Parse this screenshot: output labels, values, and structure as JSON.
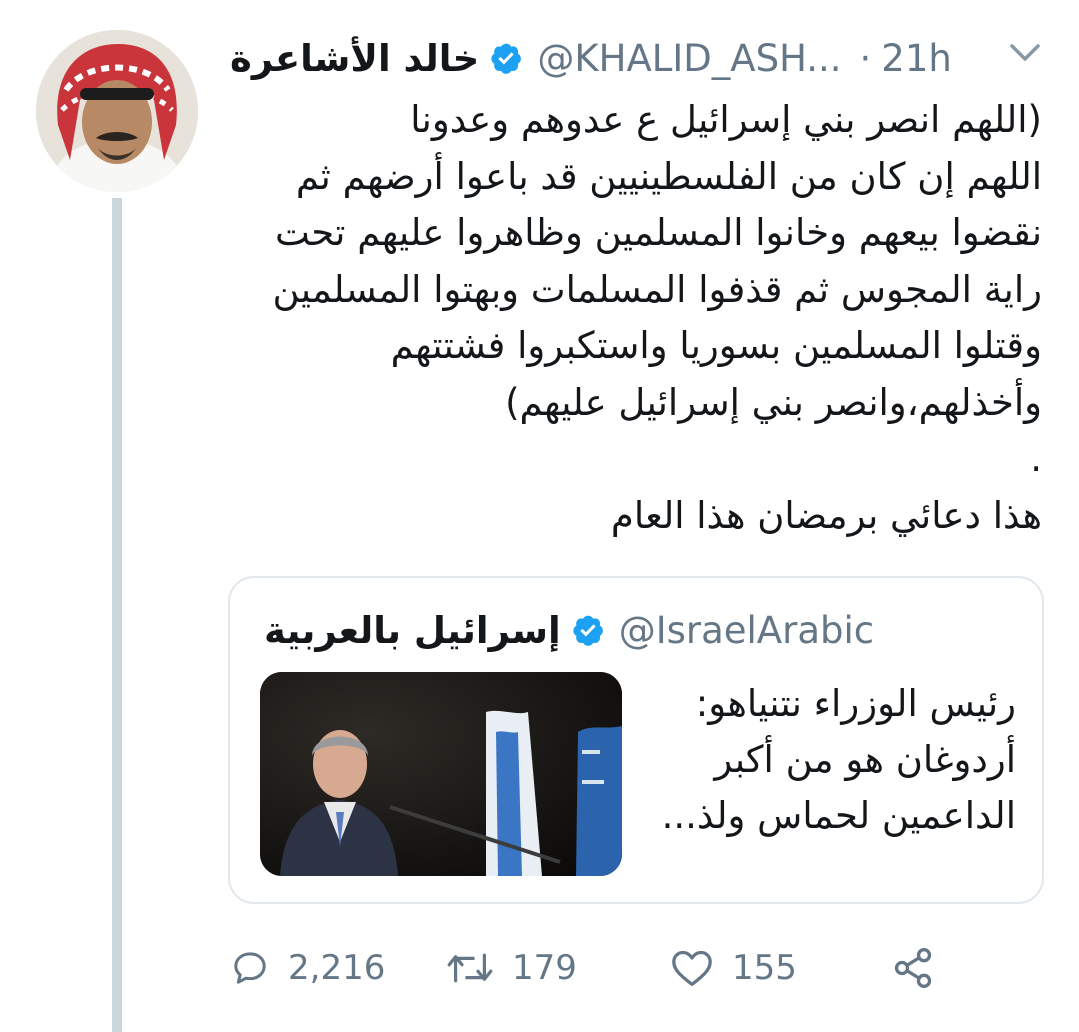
{
  "tweet": {
    "author": {
      "display_name": "خالد الأشاعرة",
      "handle": "@KHALID_ASH...",
      "verified": true,
      "avatar_icon": "profile-photo-man-red-shemagh"
    },
    "separator": "·",
    "timestamp": "21h",
    "text": "(اللهم انصر بني إسرائيل ع عدوهم وعدونا\nاللهم إن كان من الفلسطينيين قد باعوا أرضهم ثم\nنقضوا بيعهم وخانوا المسلمين وظاهروا عليهم تحت\nراية المجوس ثم قذفوا المسلمات وبهتوا المسلمين\nوقتلوا المسلمين بسوريا واستكبروا فشتتهم\nوأخذلهم،وانصر بني إسرائيل عليهم)\n.\nهذا دعائي برمضان هذا العام",
    "quoted": {
      "display_name": "إسرائيل بالعربية",
      "handle": "@IsraelArabic",
      "verified": true,
      "text": "رئيس الوزراء نتنياهو:\nأردوغان هو من أكبر\nالداعمين لحماس ولذ...",
      "image_icon": "photo-man-suit-israeli-flags"
    },
    "actions": {
      "replies": "2,216",
      "retweets": "179",
      "likes": "155"
    }
  },
  "colors": {
    "verified_blue": "#1da1f2",
    "muted_gray": "#657786",
    "border": "#e1e8ed",
    "thread_line": "#ccd6dd"
  }
}
